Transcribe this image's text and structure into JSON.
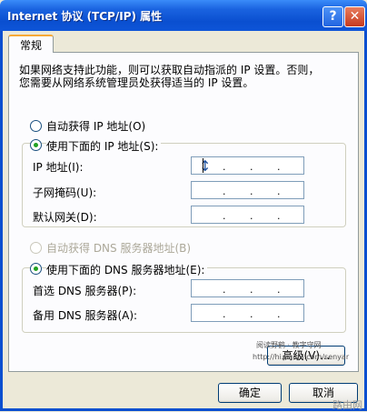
{
  "window": {
    "title": "Internet 协议 (TCP/IP) 属性",
    "help_label": "?",
    "close_label": "✕"
  },
  "tab": {
    "label": "常规"
  },
  "description": {
    "line1": "如果网络支持此功能，则可以获取自动指派的 IP 设置。否则，",
    "line2": "您需要从网络系统管理员处获得适当的 IP 设置。"
  },
  "ip": {
    "auto_label": "自动获得 IP 地址(O)",
    "manual_label": "使用下面的 IP 地址(S):",
    "address_label": "IP 地址(I):",
    "mask_label": "子网掩码(U):",
    "gateway_label": "默认网关(D):"
  },
  "dns": {
    "auto_label": "自动获得 DNS 服务器地址(B)",
    "manual_label": "使用下面的 DNS 服务器地址(E):",
    "preferred_label": "首选 DNS 服务器(P):",
    "alternate_label": "备用 DNS 服务器(A):"
  },
  "buttons": {
    "advanced": "高级(V)...",
    "ok": "确定",
    "cancel": "取消"
  },
  "watermark": {
    "line1": "阅读野鹤 · 教字守网",
    "line2": "http://hi.baidu.com/senyar",
    "corner": "路由网"
  },
  "ip_dot": "."
}
